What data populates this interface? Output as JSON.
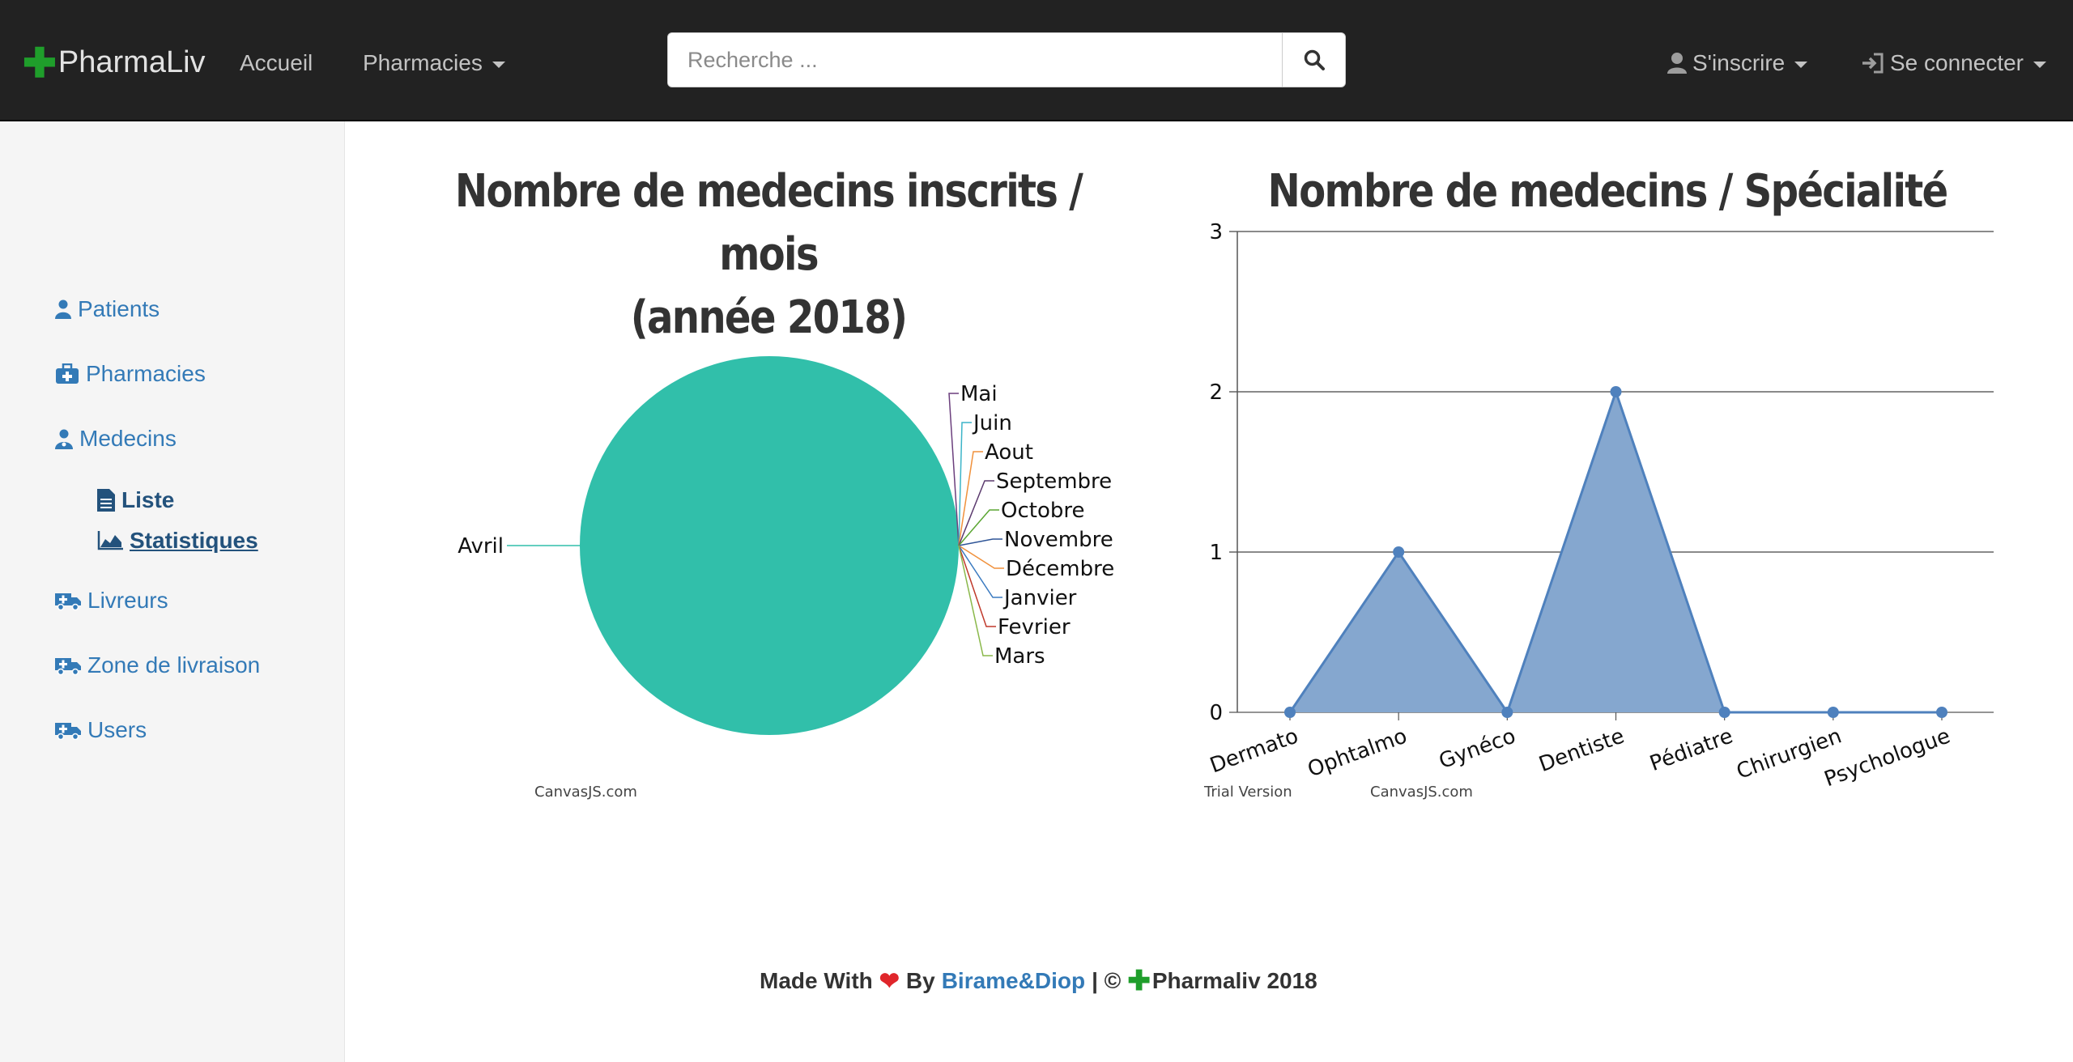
{
  "brand": {
    "plus": "✚",
    "name": "PharmaLiv"
  },
  "nav": {
    "home": "Accueil",
    "pharmacies": "Pharmacies",
    "signup": "S'inscrire",
    "login": "Se connecter"
  },
  "search": {
    "placeholder": "Recherche ..."
  },
  "sidebar": {
    "items": [
      {
        "label": "Patients",
        "icon": "user-icon"
      },
      {
        "label": "Pharmacies",
        "icon": "medkit-icon"
      },
      {
        "label": "Medecins",
        "icon": "user-md-icon"
      },
      {
        "label": "Liste",
        "icon": "file-text-icon"
      },
      {
        "label": "Statistiques",
        "icon": "area-chart-icon"
      },
      {
        "label": "Livreurs",
        "icon": "ambulance-icon"
      },
      {
        "label": "Zone de livraison",
        "icon": "ambulance-icon"
      },
      {
        "label": "Users",
        "icon": "ambulance-icon"
      }
    ]
  },
  "chart_data": [
    {
      "type": "pie",
      "title": "Nombre de medecins inscrits / mois (année 2018)",
      "title_lines": [
        "Nombre de medecins inscrits / mois",
        "(année 2018)"
      ],
      "categories": [
        "Avril",
        "Mai",
        "Juin",
        "Aout",
        "Septembre",
        "Octobre",
        "Novembre",
        "Décembre",
        "Janvier",
        "Fevrier",
        "Mars"
      ],
      "values": [
        3,
        0,
        0,
        0,
        0,
        0,
        0,
        0,
        0,
        0,
        0
      ],
      "colors": [
        "#31bfaa",
        "#6b3f7d",
        "#3cb4c8",
        "#f0913c",
        "#5b3a6e",
        "#5aa632",
        "#2f5597",
        "#f0913c",
        "#3a7ac0",
        "#c0392b",
        "#8ab84a"
      ],
      "credit": "CanvasJS.com"
    },
    {
      "type": "area",
      "title": "Nombre de medecins / Spécialité",
      "categories": [
        "Dermato",
        "Ophtalmo",
        "Gynéco",
        "Dentiste",
        "Pédiatre",
        "Chirurgien",
        "Psychologue"
      ],
      "values": [
        0,
        1,
        0,
        2,
        0,
        0,
        0
      ],
      "ylim": [
        0,
        3
      ],
      "yticks": [
        "0",
        "1",
        "2",
        "3"
      ],
      "grid": true,
      "color": "#4f81bd",
      "fill": "#85a7cf",
      "watermark": "Trial Version",
      "credit": "CanvasJS.com"
    }
  ],
  "footer": {
    "made_with": "Made With",
    "heart": "❤",
    "by": "By",
    "authors": "Birame&Diop",
    "rest": "| ©",
    "plus": "✚",
    "brand": "Pharmaliv 2018"
  }
}
